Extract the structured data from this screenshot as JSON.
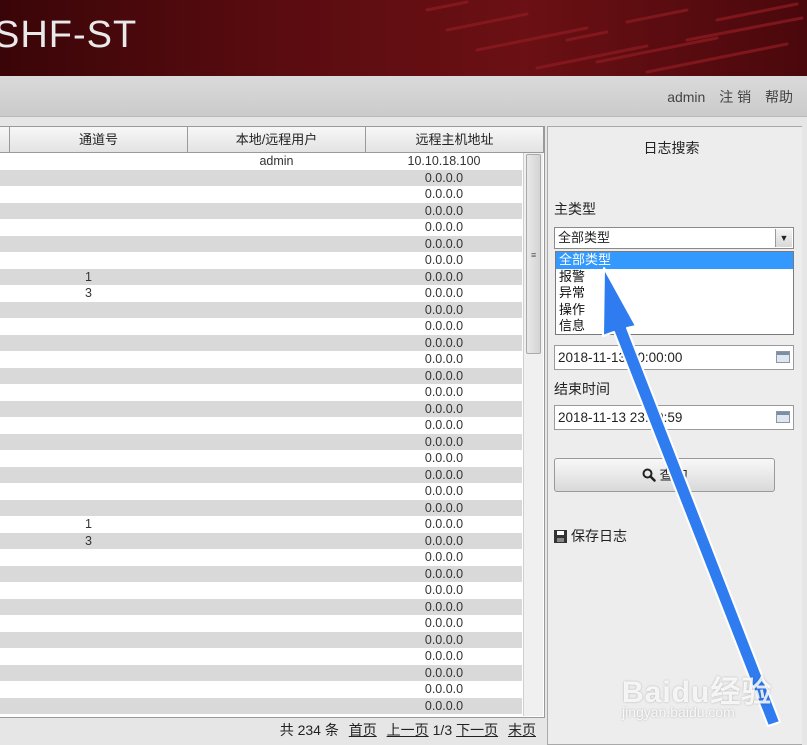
{
  "header": {
    "title": "SHF-ST"
  },
  "nav": {
    "user": "admin",
    "logout": "注 销",
    "help": "帮助"
  },
  "table": {
    "columns": [
      "通道号",
      "本地/远程用户",
      "远程主机地址"
    ],
    "rows": [
      {
        "channel": "",
        "user": "admin",
        "host": "10.10.18.100"
      },
      {
        "channel": "",
        "user": "",
        "host": "0.0.0.0"
      },
      {
        "channel": "",
        "user": "",
        "host": "0.0.0.0"
      },
      {
        "channel": "",
        "user": "",
        "host": "0.0.0.0"
      },
      {
        "channel": "",
        "user": "",
        "host": "0.0.0.0"
      },
      {
        "channel": "",
        "user": "",
        "host": "0.0.0.0"
      },
      {
        "channel": "",
        "user": "",
        "host": "0.0.0.0"
      },
      {
        "channel": "1",
        "user": "",
        "host": "0.0.0.0"
      },
      {
        "channel": "3",
        "user": "",
        "host": "0.0.0.0"
      },
      {
        "channel": "",
        "user": "",
        "host": "0.0.0.0"
      },
      {
        "channel": "",
        "user": "",
        "host": "0.0.0.0"
      },
      {
        "channel": "",
        "user": "",
        "host": "0.0.0.0"
      },
      {
        "channel": "",
        "user": "",
        "host": "0.0.0.0"
      },
      {
        "channel": "",
        "user": "",
        "host": "0.0.0.0"
      },
      {
        "channel": "",
        "user": "",
        "host": "0.0.0.0"
      },
      {
        "channel": "",
        "user": "",
        "host": "0.0.0.0"
      },
      {
        "channel": "",
        "user": "",
        "host": "0.0.0.0"
      },
      {
        "channel": "",
        "user": "",
        "host": "0.0.0.0"
      },
      {
        "channel": "",
        "user": "",
        "host": "0.0.0.0"
      },
      {
        "channel": "",
        "user": "",
        "host": "0.0.0.0"
      },
      {
        "channel": "",
        "user": "",
        "host": "0.0.0.0"
      },
      {
        "channel": "",
        "user": "",
        "host": "0.0.0.0"
      },
      {
        "channel": "1",
        "user": "",
        "host": "0.0.0.0"
      },
      {
        "channel": "3",
        "user": "",
        "host": "0.0.0.0"
      },
      {
        "channel": "",
        "user": "",
        "host": "0.0.0.0"
      },
      {
        "channel": "",
        "user": "",
        "host": "0.0.0.0"
      },
      {
        "channel": "",
        "user": "",
        "host": "0.0.0.0"
      },
      {
        "channel": "",
        "user": "",
        "host": "0.0.0.0"
      },
      {
        "channel": "",
        "user": "",
        "host": "0.0.0.0"
      },
      {
        "channel": "",
        "user": "",
        "host": "0.0.0.0"
      },
      {
        "channel": "",
        "user": "",
        "host": "0.0.0.0"
      },
      {
        "channel": "",
        "user": "",
        "host": "0.0.0.0"
      },
      {
        "channel": "",
        "user": "",
        "host": "0.0.0.0"
      },
      {
        "channel": "",
        "user": "",
        "host": "0.0.0.0"
      }
    ]
  },
  "pager": {
    "total": "共 234 条",
    "first": "首页",
    "prev": "上一页",
    "page": "1/3",
    "next": "下一页",
    "last": "末页"
  },
  "panel": {
    "title": "日志搜索",
    "main_type_label": "主类型",
    "main_type_value": "全部类型",
    "main_type_options": [
      "全部类型",
      "报警",
      "异常",
      "操作",
      "信息"
    ],
    "start_time_value": "2018-11-13 00:00:00",
    "end_time_label": "结束时间",
    "end_time_value": "2018-11-13 23:59:59",
    "search_label": "查询",
    "save_label": "保存日志"
  },
  "watermark": {
    "brand": "Baidu经验",
    "url": "jingyan.baidu.com"
  },
  "colors": {
    "header": "#5a0c10",
    "alt_row": "#d9d9d9",
    "selected": "#3399ff",
    "arrow": "#2f7cf0"
  }
}
